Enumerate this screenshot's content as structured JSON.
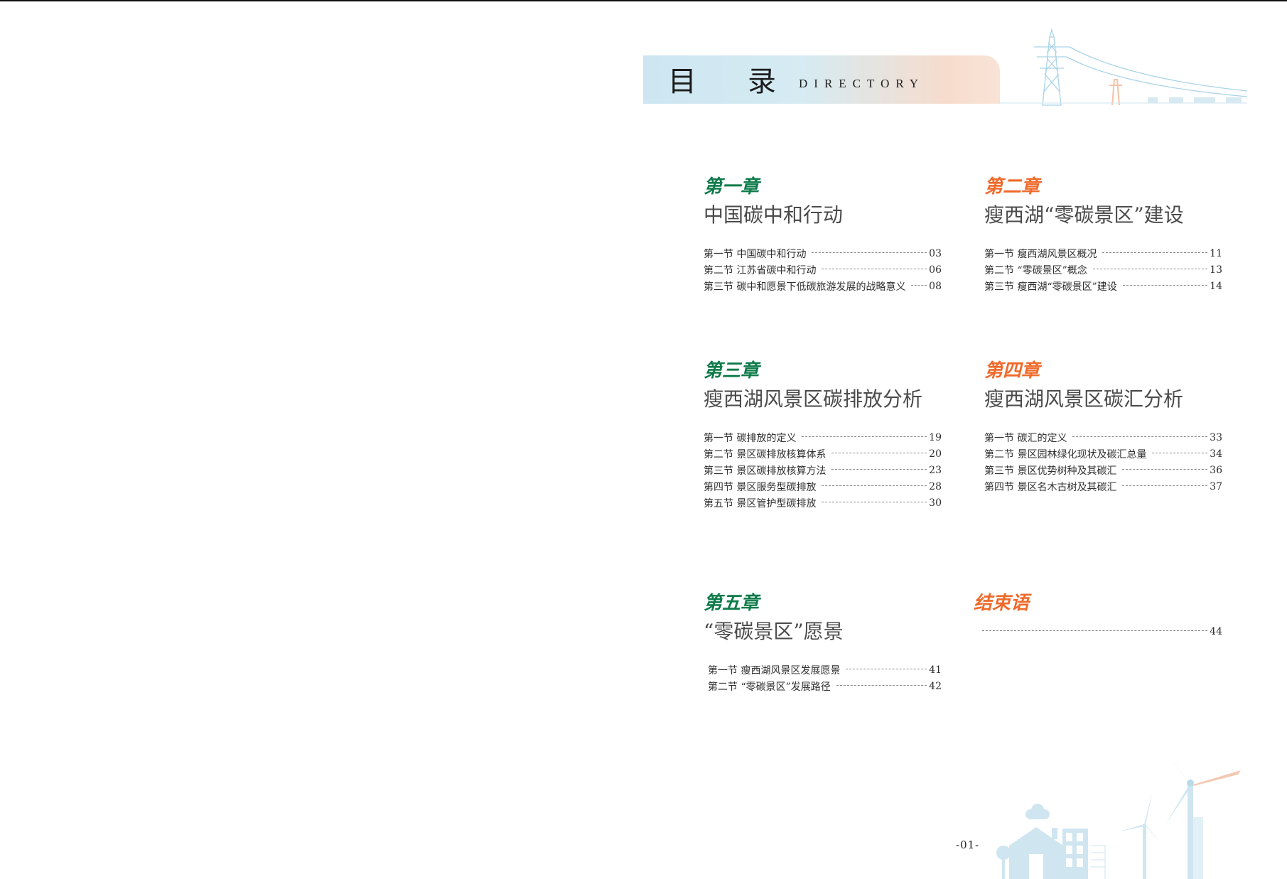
{
  "banner": {
    "title_1": "目",
    "title_2": "录",
    "subtitle": "DIRECTORY"
  },
  "chapters": [
    {
      "label": "第一章",
      "title": "中国碳中和行动",
      "sections": [
        {
          "name": "第一节  中国碳中和行动",
          "page": "03"
        },
        {
          "name": "第二节  江苏省碳中和行动",
          "page": "06"
        },
        {
          "name": "第三节  碳中和愿景下低碳旅游发展的战略意义",
          "page": "08"
        }
      ]
    },
    {
      "label": "第二章",
      "title": "瘦西湖“零碳景区”建设",
      "sections": [
        {
          "name": "第一节  瘦西湖风景区概况",
          "page": "11"
        },
        {
          "name": "第二节  “零碳景区”概念",
          "page": "13"
        },
        {
          "name": "第三节  瘦西湖“零碳景区”建设",
          "page": "14"
        }
      ]
    },
    {
      "label": "第三章",
      "title": "瘦西湖风景区碳排放分析",
      "sections": [
        {
          "name": "第一节  碳排放的定义",
          "page": "19"
        },
        {
          "name": "第二节  景区碳排放核算体系",
          "page": "20"
        },
        {
          "name": "第三节  景区碳排放核算方法",
          "page": "23"
        },
        {
          "name": "第四节  景区服务型碳排放",
          "page": "28"
        },
        {
          "name": "第五节  景区管护型碳排放",
          "page": "30"
        }
      ]
    },
    {
      "label": "第四章",
      "title": "瘦西湖风景区碳汇分析",
      "sections": [
        {
          "name": "第一节  碳汇的定义",
          "page": "33"
        },
        {
          "name": "第二节  景区园林绿化现状及碳汇总量",
          "page": "34"
        },
        {
          "name": "第三节  景区优势树种及其碳汇",
          "page": "36"
        },
        {
          "name": "第四节  景区名木古树及其碳汇",
          "page": "37"
        }
      ]
    },
    {
      "label": "第五章",
      "title": "“零碳景区”愿景",
      "sections": [
        {
          "name": "第一节  瘦西湖风景区发展愿景",
          "page": "41"
        },
        {
          "name": "第二节  “零碳景区”发展路径",
          "page": "42"
        }
      ]
    },
    {
      "label": "结束语",
      "title": "",
      "sections": [
        {
          "name": "",
          "page": "44"
        }
      ]
    }
  ],
  "footer": {
    "page_number": "-01-"
  },
  "colors": {
    "green": "#0e7a4a",
    "orange": "#ef6a2a"
  }
}
